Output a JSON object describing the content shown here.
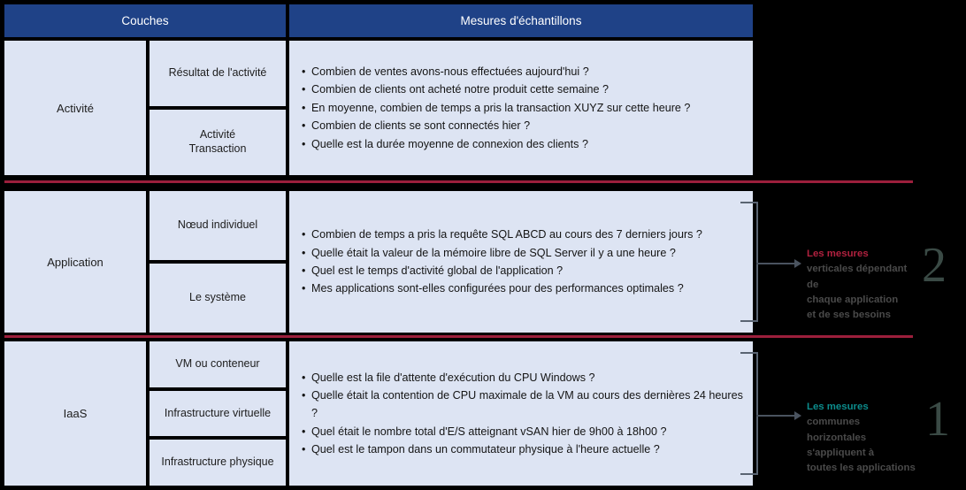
{
  "header": {
    "col_layers": "Couches",
    "col_measures": "Mesures d'échantillons"
  },
  "rows": [
    {
      "layer": "Activité",
      "sublayers": [
        "Résultat de l'activité",
        "Activité\nTransaction"
      ],
      "measures": [
        "Combien de ventes avons-nous effectuées aujourd'hui ?",
        "Combien de clients ont acheté notre produit cette semaine ?",
        "En moyenne, combien de temps a pris la transaction XUYZ sur cette heure ?",
        "Combien de clients se sont connectés hier ?",
        "Quelle est la durée moyenne de connexion des clients ?"
      ]
    },
    {
      "layer": "Application",
      "sublayers": [
        "Nœud individuel",
        "Le système"
      ],
      "measures": [
        "Combien de temps a pris la requête SQL ABCD au cours des 7 derniers jours ?",
        "Quelle était la valeur de la mémoire libre de SQL Server il y a une heure ?",
        "Quel est le temps d'activité global de l'application ?",
        "Mes applications sont-elles configurées pour des performances optimales ?"
      ]
    },
    {
      "layer": "IaaS",
      "sublayers": [
        "VM ou conteneur",
        "Infrastructure virtuelle",
        "Infrastructure physique"
      ],
      "measures": [
        "Quelle est la file d'attente d'exécution du CPU Windows ?",
        "Quelle était la contention de CPU maximale de la VM au cours des dernières 24 heures ?",
        "Quel était le nombre total d'E/S atteignant vSAN hier de 9h00 à 18h00 ?",
        "Quel est le tampon dans un commutateur physique à l'heure actuelle ?"
      ]
    }
  ],
  "callouts": [
    {
      "number": "2",
      "title": "Les mesures",
      "body": "verticales dépendant de\nchaque application\net de ses besoins",
      "title_color": "#b1213f"
    },
    {
      "number": "1",
      "title": "Les mesures",
      "body": "communes horizontales\ns'appliquent à\ntoutes les applications",
      "title_color": "#0c8c8c"
    }
  ],
  "colors": {
    "header_blue": "#1f4287",
    "cell_blue": "#dde4f3",
    "separator_crimson": "#9c1f3c",
    "background": "#000000",
    "number_gray": "#3a4a45",
    "bracket_gray": "#5a6472"
  }
}
